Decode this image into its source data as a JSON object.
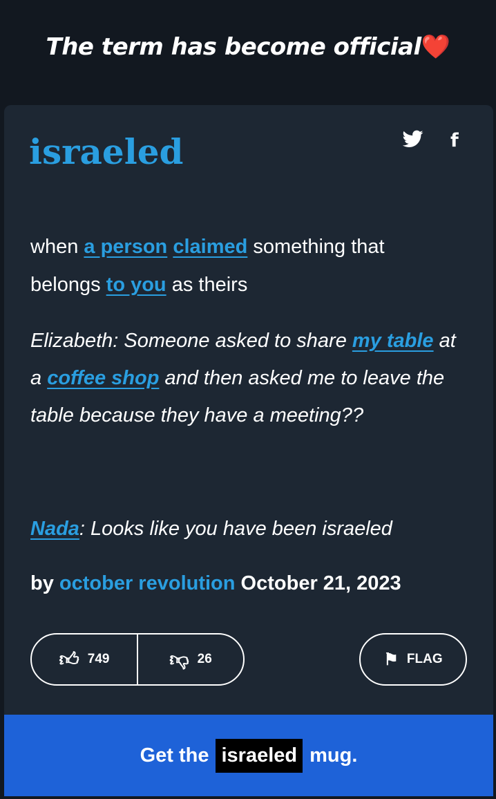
{
  "caption": {
    "text": "The term has become official",
    "emoji": "❤️"
  },
  "entry": {
    "word": "israeled",
    "share": {
      "twitter_icon": "twitter-icon",
      "facebook_icon": "facebook-icon"
    },
    "meaning": {
      "t1": "when ",
      "l1": "a person",
      "t2": " ",
      "l2": "claimed",
      "t3": " something that belongs ",
      "l3": "to you",
      "t4": " as theirs"
    },
    "example": {
      "t1": "Elizabeth: Someone asked to share ",
      "l1": "my table",
      "t2": " at a ",
      "l2": "coffee shop",
      "t3": " and then asked me to leave the table because they have a meeting??"
    },
    "example2": {
      "l1": "Nada",
      "t1": ": Looks like you have been israeled"
    },
    "byline": {
      "by": "by",
      "author": "october revolution",
      "date": "October 21, 2023"
    },
    "votes": {
      "up": "749",
      "down": "26"
    },
    "flag_label": "FLAG"
  },
  "mug": {
    "prefix": "Get the",
    "word": "israeled",
    "suffix": "mug."
  },
  "colors": {
    "link": "#2a9ee0",
    "card": "#1d2733",
    "mug_banner": "#1e62d8"
  }
}
